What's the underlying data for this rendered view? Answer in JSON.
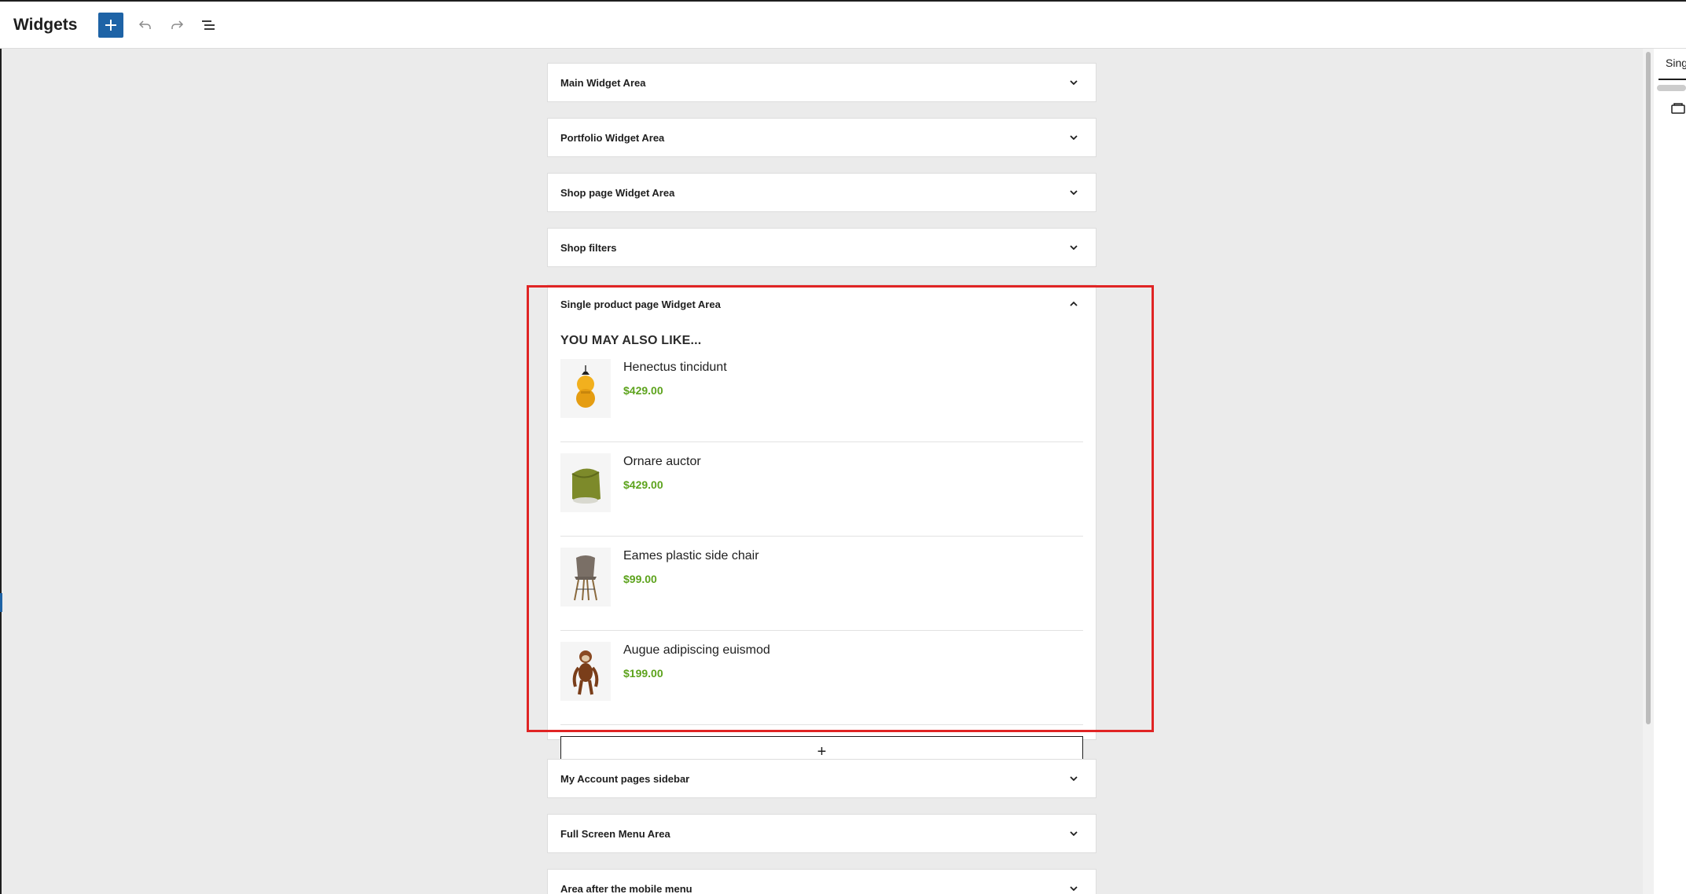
{
  "header": {
    "title": "Widgets",
    "add_icon": "plus-icon",
    "undo_icon": "undo-icon",
    "redo_icon": "redo-icon",
    "list_view_icon": "list-view-icon"
  },
  "areas_top": [
    {
      "title": "Main Widget Area"
    },
    {
      "title": "Portfolio Widget Area"
    },
    {
      "title": "Shop page Widget Area"
    },
    {
      "title": "Shop filters"
    }
  ],
  "open_area": {
    "title": "Single product page Widget Area",
    "widget_heading": "YOU MAY ALSO LIKE...",
    "products": [
      {
        "name": "Henectus tincidunt",
        "price": "$429.00",
        "image": "pendant-lamp"
      },
      {
        "name": "Ornare auctor",
        "price": "$429.00",
        "image": "green-stool"
      },
      {
        "name": "Eames plastic side chair",
        "price": "$99.00",
        "image": "chair"
      },
      {
        "name": "Augue adipiscing euismod",
        "price": "$199.00",
        "image": "wooden-monkey"
      }
    ],
    "appender_label": "+"
  },
  "areas_bottom": [
    {
      "title": "My Account pages sidebar"
    },
    {
      "title": "Full Screen Menu Area"
    },
    {
      "title": "Area after the mobile menu"
    }
  ],
  "sidebar": {
    "tab_label": "Sing",
    "icon": "widget-area-icon"
  },
  "colors": {
    "accent": "#1e63a6",
    "price": "#5da31d",
    "highlight": "#e02424"
  }
}
